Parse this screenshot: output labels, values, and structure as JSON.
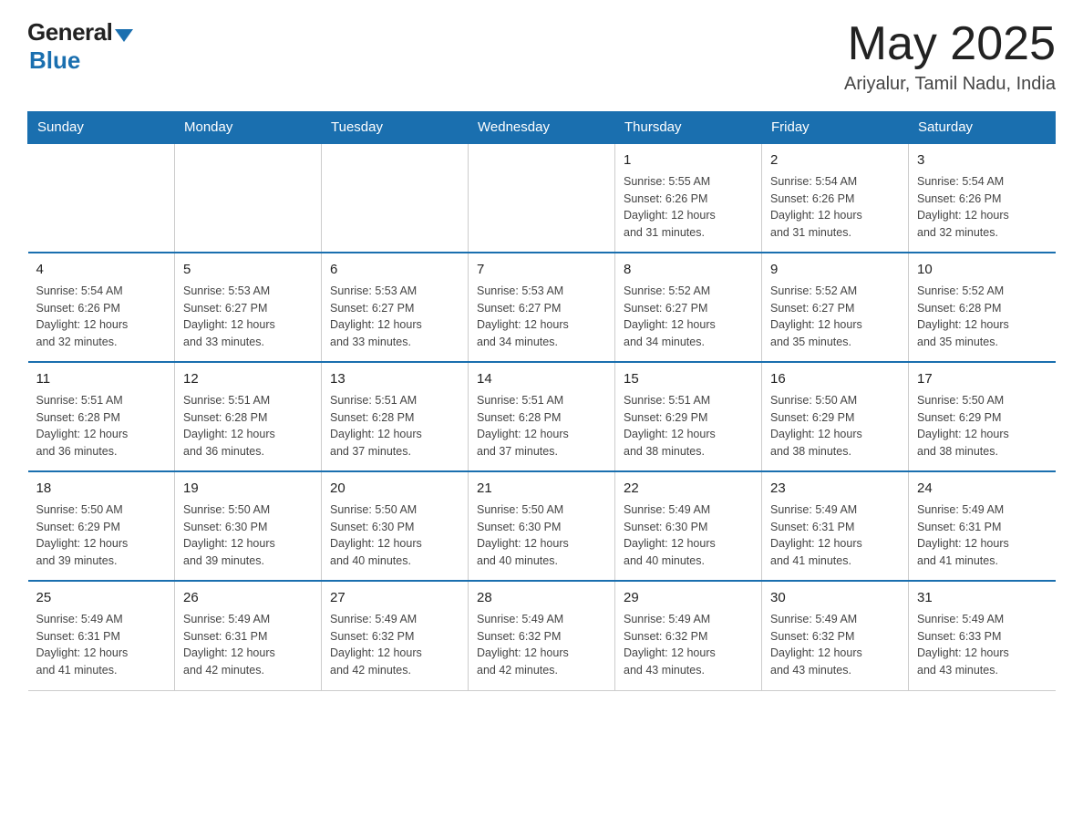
{
  "header": {
    "logo_general": "General",
    "logo_blue": "Blue",
    "month_title": "May 2025",
    "location": "Ariyalur, Tamil Nadu, India"
  },
  "days_of_week": [
    "Sunday",
    "Monday",
    "Tuesday",
    "Wednesday",
    "Thursday",
    "Friday",
    "Saturday"
  ],
  "weeks": [
    [
      {
        "day": "",
        "info": ""
      },
      {
        "day": "",
        "info": ""
      },
      {
        "day": "",
        "info": ""
      },
      {
        "day": "",
        "info": ""
      },
      {
        "day": "1",
        "info": "Sunrise: 5:55 AM\nSunset: 6:26 PM\nDaylight: 12 hours\nand 31 minutes."
      },
      {
        "day": "2",
        "info": "Sunrise: 5:54 AM\nSunset: 6:26 PM\nDaylight: 12 hours\nand 31 minutes."
      },
      {
        "day": "3",
        "info": "Sunrise: 5:54 AM\nSunset: 6:26 PM\nDaylight: 12 hours\nand 32 minutes."
      }
    ],
    [
      {
        "day": "4",
        "info": "Sunrise: 5:54 AM\nSunset: 6:26 PM\nDaylight: 12 hours\nand 32 minutes."
      },
      {
        "day": "5",
        "info": "Sunrise: 5:53 AM\nSunset: 6:27 PM\nDaylight: 12 hours\nand 33 minutes."
      },
      {
        "day": "6",
        "info": "Sunrise: 5:53 AM\nSunset: 6:27 PM\nDaylight: 12 hours\nand 33 minutes."
      },
      {
        "day": "7",
        "info": "Sunrise: 5:53 AM\nSunset: 6:27 PM\nDaylight: 12 hours\nand 34 minutes."
      },
      {
        "day": "8",
        "info": "Sunrise: 5:52 AM\nSunset: 6:27 PM\nDaylight: 12 hours\nand 34 minutes."
      },
      {
        "day": "9",
        "info": "Sunrise: 5:52 AM\nSunset: 6:27 PM\nDaylight: 12 hours\nand 35 minutes."
      },
      {
        "day": "10",
        "info": "Sunrise: 5:52 AM\nSunset: 6:28 PM\nDaylight: 12 hours\nand 35 minutes."
      }
    ],
    [
      {
        "day": "11",
        "info": "Sunrise: 5:51 AM\nSunset: 6:28 PM\nDaylight: 12 hours\nand 36 minutes."
      },
      {
        "day": "12",
        "info": "Sunrise: 5:51 AM\nSunset: 6:28 PM\nDaylight: 12 hours\nand 36 minutes."
      },
      {
        "day": "13",
        "info": "Sunrise: 5:51 AM\nSunset: 6:28 PM\nDaylight: 12 hours\nand 37 minutes."
      },
      {
        "day": "14",
        "info": "Sunrise: 5:51 AM\nSunset: 6:28 PM\nDaylight: 12 hours\nand 37 minutes."
      },
      {
        "day": "15",
        "info": "Sunrise: 5:51 AM\nSunset: 6:29 PM\nDaylight: 12 hours\nand 38 minutes."
      },
      {
        "day": "16",
        "info": "Sunrise: 5:50 AM\nSunset: 6:29 PM\nDaylight: 12 hours\nand 38 minutes."
      },
      {
        "day": "17",
        "info": "Sunrise: 5:50 AM\nSunset: 6:29 PM\nDaylight: 12 hours\nand 38 minutes."
      }
    ],
    [
      {
        "day": "18",
        "info": "Sunrise: 5:50 AM\nSunset: 6:29 PM\nDaylight: 12 hours\nand 39 minutes."
      },
      {
        "day": "19",
        "info": "Sunrise: 5:50 AM\nSunset: 6:30 PM\nDaylight: 12 hours\nand 39 minutes."
      },
      {
        "day": "20",
        "info": "Sunrise: 5:50 AM\nSunset: 6:30 PM\nDaylight: 12 hours\nand 40 minutes."
      },
      {
        "day": "21",
        "info": "Sunrise: 5:50 AM\nSunset: 6:30 PM\nDaylight: 12 hours\nand 40 minutes."
      },
      {
        "day": "22",
        "info": "Sunrise: 5:49 AM\nSunset: 6:30 PM\nDaylight: 12 hours\nand 40 minutes."
      },
      {
        "day": "23",
        "info": "Sunrise: 5:49 AM\nSunset: 6:31 PM\nDaylight: 12 hours\nand 41 minutes."
      },
      {
        "day": "24",
        "info": "Sunrise: 5:49 AM\nSunset: 6:31 PM\nDaylight: 12 hours\nand 41 minutes."
      }
    ],
    [
      {
        "day": "25",
        "info": "Sunrise: 5:49 AM\nSunset: 6:31 PM\nDaylight: 12 hours\nand 41 minutes."
      },
      {
        "day": "26",
        "info": "Sunrise: 5:49 AM\nSunset: 6:31 PM\nDaylight: 12 hours\nand 42 minutes."
      },
      {
        "day": "27",
        "info": "Sunrise: 5:49 AM\nSunset: 6:32 PM\nDaylight: 12 hours\nand 42 minutes."
      },
      {
        "day": "28",
        "info": "Sunrise: 5:49 AM\nSunset: 6:32 PM\nDaylight: 12 hours\nand 42 minutes."
      },
      {
        "day": "29",
        "info": "Sunrise: 5:49 AM\nSunset: 6:32 PM\nDaylight: 12 hours\nand 43 minutes."
      },
      {
        "day": "30",
        "info": "Sunrise: 5:49 AM\nSunset: 6:32 PM\nDaylight: 12 hours\nand 43 minutes."
      },
      {
        "day": "31",
        "info": "Sunrise: 5:49 AM\nSunset: 6:33 PM\nDaylight: 12 hours\nand 43 minutes."
      }
    ]
  ]
}
